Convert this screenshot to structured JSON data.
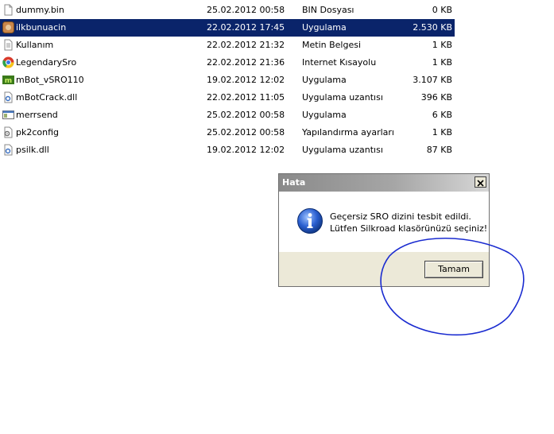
{
  "files": [
    {
      "name": "dummy.bin",
      "date": "25.02.2012 00:58",
      "type": "BIN Dosyası",
      "size": "0 KB",
      "icon": "file-icon",
      "selected": false
    },
    {
      "name": "ilkbunuacin",
      "date": "22.02.2012 17:45",
      "type": "Uygulama",
      "size": "2.530 KB",
      "icon": "app-icon",
      "selected": true
    },
    {
      "name": "Kullanım",
      "date": "22.02.2012 21:32",
      "type": "Metin Belgesi",
      "size": "1 KB",
      "icon": "text-file-icon",
      "selected": false
    },
    {
      "name": "LegendarySro",
      "date": "22.02.2012 21:36",
      "type": "Internet Kısayolu",
      "size": "1 KB",
      "icon": "chrome-icon",
      "selected": false
    },
    {
      "name": "mBot_vSRO110",
      "date": "19.02.2012 12:02",
      "type": "Uygulama",
      "size": "3.107 KB",
      "icon": "mbot-icon",
      "selected": false
    },
    {
      "name": "mBotCrack.dll",
      "date": "22.02.2012 11:05",
      "type": "Uygulama uzantısı",
      "size": "396 KB",
      "icon": "dll-icon",
      "selected": false
    },
    {
      "name": "merrsend",
      "date": "25.02.2012 00:58",
      "type": "Uygulama",
      "size": "6 KB",
      "icon": "window-app-icon",
      "selected": false
    },
    {
      "name": "pk2config",
      "date": "25.02.2012 00:58",
      "type": "Yapılandırma ayarları",
      "size": "1 KB",
      "icon": "config-icon",
      "selected": false
    },
    {
      "name": "psilk.dll",
      "date": "19.02.2012 12:02",
      "type": "Uygulama uzantısı",
      "size": "87 KB",
      "icon": "dll-icon",
      "selected": false
    }
  ],
  "dialog": {
    "title": "Hata",
    "message_line1": "Geçersiz SRO dizini tesbit edildi.",
    "message_line2": "Lütfen Silkroad klasörünüzü seçiniz!",
    "ok_label": "Tamam",
    "icon": "info-icon",
    "close_icon": "close-icon"
  },
  "colors": {
    "selection": "#0a246a",
    "annotation_circle": "#1a2bd0",
    "dialog_face": "#ece9d8"
  }
}
